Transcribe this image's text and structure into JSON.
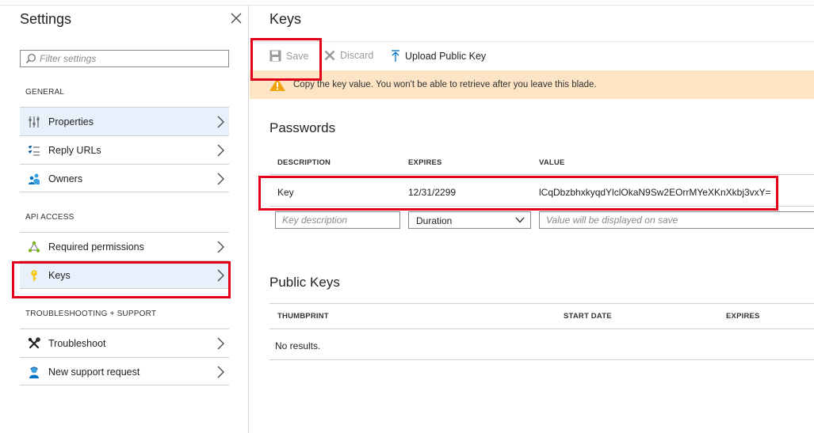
{
  "settings": {
    "title": "Settings",
    "filter_placeholder": "Filter settings",
    "sections": {
      "general": "GENERAL",
      "api_access": "API ACCESS",
      "troubleshooting": "TROUBLESHOOTING + SUPPORT"
    },
    "items": {
      "properties": "Properties",
      "reply_urls": "Reply URLs",
      "owners": "Owners",
      "required_permissions": "Required permissions",
      "keys": "Keys",
      "troubleshoot": "Troubleshoot",
      "new_support_request": "New support request"
    }
  },
  "keys": {
    "title": "Keys",
    "toolbar": {
      "save": "Save",
      "discard": "Discard",
      "upload": "Upload Public Key"
    },
    "banner": "Copy the key value. You won't be able to retrieve after you leave this blade.",
    "passwords": {
      "heading": "Passwords",
      "columns": [
        "DESCRIPTION",
        "EXPIRES",
        "VALUE"
      ],
      "row": {
        "description": "Key",
        "expires": "12/31/2299",
        "value": "lCqDbzbhxkyqdYlclOkaN9Sw2EOrrMYeXKnXkbj3vxY="
      },
      "new_row": {
        "description_placeholder": "Key description",
        "duration": "Duration",
        "value_placeholder": "Value will be displayed on save"
      }
    },
    "public_keys": {
      "heading": "Public Keys",
      "columns": [
        "THUMBPRINT",
        "START DATE",
        "EXPIRES"
      ],
      "empty": "No results."
    }
  },
  "colors": {
    "highlight": "#e3001b",
    "selected": "#e8f1fb",
    "banner": "#fce4c4",
    "accent": "#0072c6"
  }
}
